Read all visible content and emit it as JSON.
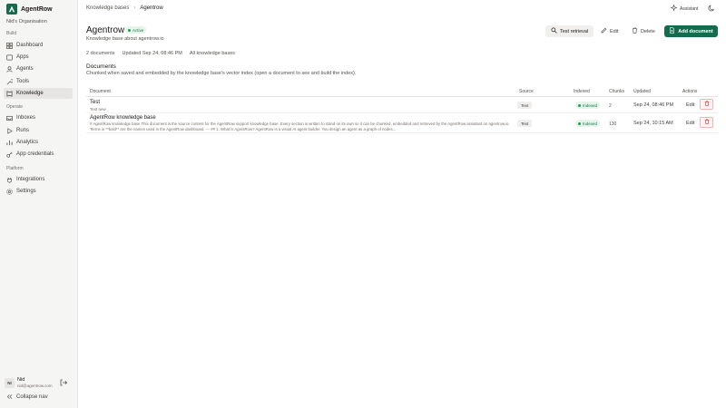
{
  "app": {
    "name": "AgentRow",
    "org": "Nid's Organisation"
  },
  "sidebar": {
    "sections": [
      {
        "label": "Build",
        "items": [
          {
            "label": "Dashboard",
            "icon": "grid-icon"
          },
          {
            "label": "Apps",
            "icon": "apps-icon"
          },
          {
            "label": "Agents",
            "icon": "agent-icon"
          },
          {
            "label": "Tools",
            "icon": "wrench-icon"
          },
          {
            "label": "Knowledge",
            "icon": "book-icon",
            "active": true
          }
        ]
      },
      {
        "label": "Operate",
        "items": [
          {
            "label": "Inboxes",
            "icon": "inbox-icon"
          },
          {
            "label": "Runs",
            "icon": "play-icon"
          },
          {
            "label": "Analytics",
            "icon": "chart-icon"
          },
          {
            "label": "App credentials",
            "icon": "key-icon"
          }
        ]
      },
      {
        "label": "Platform",
        "items": [
          {
            "label": "Integrations",
            "icon": "plug-icon"
          },
          {
            "label": "Settings",
            "icon": "gear-icon"
          }
        ]
      }
    ],
    "user": {
      "initials": "NI",
      "name": "Nid",
      "email": "nid@agentrow.com"
    },
    "collapse_label": "Collapse nav"
  },
  "breadcrumb": {
    "parent": "Knowledge bases",
    "current": "Agentrow"
  },
  "header": {
    "assistant_label": "Assistant"
  },
  "kb": {
    "title": "Agentrow",
    "status": "Active",
    "description": "Knowledge base about agentrow.io",
    "meta": {
      "documents": "2 documents",
      "updated": "Updated Sep 24, 08:46 PM",
      "all_link": "All knowledge bases"
    }
  },
  "actions": {
    "test_retrieval": "Test retrieval",
    "edit": "Edit",
    "delete": "Delete",
    "add_document": "Add document"
  },
  "documents": {
    "title": "Documents",
    "subtitle": "Chunked when saved and embedded by the knowledge base's vector index (open a document to see and build the index).",
    "columns": {
      "document": "Document",
      "source": "Source",
      "indexed": "Indexed",
      "chunks": "Chunks",
      "updated": "Updated",
      "actions": "Actions"
    },
    "rows": [
      {
        "name": "Test",
        "sub": "Test new",
        "source": "Text",
        "indexed": "Indexed",
        "chunks": "2",
        "updated": "Sep 24, 08:46 PM",
        "edit": "Edit"
      },
      {
        "name": "AgentRow knowledge base",
        "sub": "# AgentRow knowledge base This document is the source content for the AgentRow support knowledge base. Every section is written to stand on its own so it can be chunked, embedded and retrieved by the AgentRow assistant on agentrow.io. Terms in **bold** are the names used in the AgentRow dashboard. --- ## 1. What is AgentRow? AgentRow is a visual AI agent builder. You design an agent as a graph of nodes...",
        "source": "Text",
        "indexed": "Indexed",
        "chunks": "130",
        "updated": "Sep 24, 10:15 AM",
        "edit": "Edit"
      }
    ]
  },
  "colors": {
    "brand": "#166b4f",
    "active_green": "#16a34a",
    "danger": "#dc2626"
  }
}
